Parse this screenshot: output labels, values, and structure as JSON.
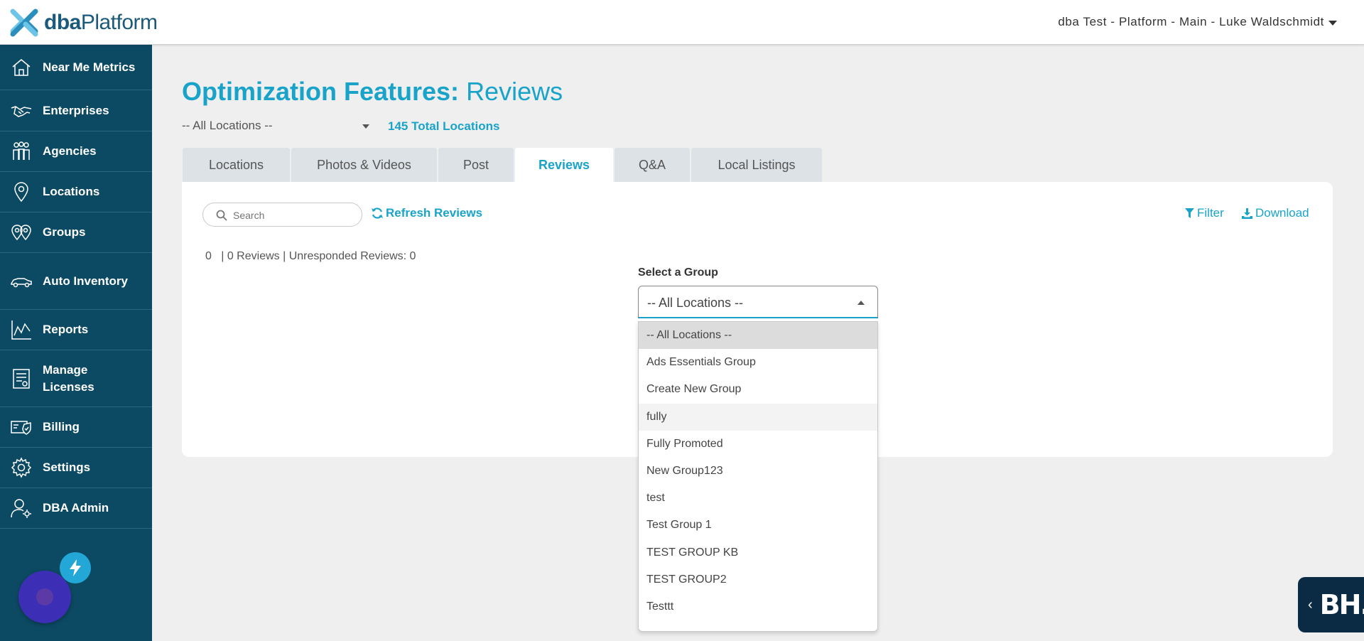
{
  "header": {
    "logo_bold": "dba",
    "logo_light": "Platform",
    "account": "dba Test - Platform - Main - Luke Waldschmidt"
  },
  "sidebar": {
    "items": [
      {
        "label": "Near Me Metrics",
        "icon": "house-icon"
      },
      {
        "label": "Enterprises",
        "icon": "handshake-icon"
      },
      {
        "label": "Agencies",
        "icon": "people-icon"
      },
      {
        "label": "Locations",
        "icon": "map-pin-icon"
      },
      {
        "label": "Groups",
        "icon": "multi-pin-icon"
      },
      {
        "label": "Auto Inventory",
        "icon": "car-icon"
      },
      {
        "label": "Reports",
        "icon": "line-chart-icon"
      },
      {
        "label": "Manage Licenses",
        "icon": "license-icon"
      },
      {
        "label": "Billing",
        "icon": "billing-icon"
      },
      {
        "label": "Settings",
        "icon": "gear-icon"
      },
      {
        "label": "DBA Admin",
        "icon": "admin-user-icon"
      }
    ]
  },
  "main": {
    "title_bold": "Optimization Features:",
    "title_light": "Reviews",
    "location_select": "-- All Locations --",
    "total_locations": "145 Total Locations",
    "tabs": [
      {
        "label": "Locations"
      },
      {
        "label": "Photos & Videos"
      },
      {
        "label": "Post"
      },
      {
        "label": "Reviews"
      },
      {
        "label": "Q&A"
      },
      {
        "label": "Local Listings"
      }
    ],
    "active_tab": "Reviews",
    "search_placeholder": "Search",
    "refresh_label": "Refresh Reviews",
    "filter_label": "Filter",
    "download_label": "Download",
    "counts": "0   | 0 Reviews | Unresponded Reviews: 0",
    "group_label": "Select a Group",
    "group_value": "-- All Locations --",
    "group_options": [
      "-- All Locations --",
      "Ads Essentials Group",
      "Create New Group",
      "fully",
      "Fully Promoted",
      "New Group123",
      "test",
      "Test Group 1",
      "TEST GROUP KB",
      "TEST GROUP2",
      "Testtt"
    ]
  },
  "widgets": {
    "badge_text": "BH."
  },
  "colors": {
    "accent": "#1aa3c9",
    "sidebar_bg": "#0c4a63",
    "page_bg": "#efefef"
  }
}
